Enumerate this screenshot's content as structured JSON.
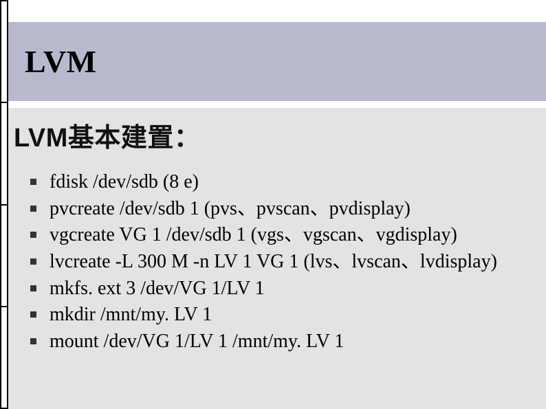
{
  "header": {
    "title": "LVM"
  },
  "subtitle": "LVM基本建置：",
  "items": [
    "fdisk /dev/sdb  (8 e)",
    "pvcreate /dev/sdb 1               (pvs、pvscan、pvdisplay)",
    "vgcreate VG 1 /dev/sdb 1       (vgs、vgscan、vgdisplay)",
    "lvcreate -L 300 M -n LV 1 VG 1 (lvs、lvscan、lvdisplay)",
    "mkfs. ext 3 /dev/VG 1/LV 1",
    "mkdir /mnt/my. LV 1",
    "mount /dev/VG 1/LV 1 /mnt/my. LV 1"
  ]
}
